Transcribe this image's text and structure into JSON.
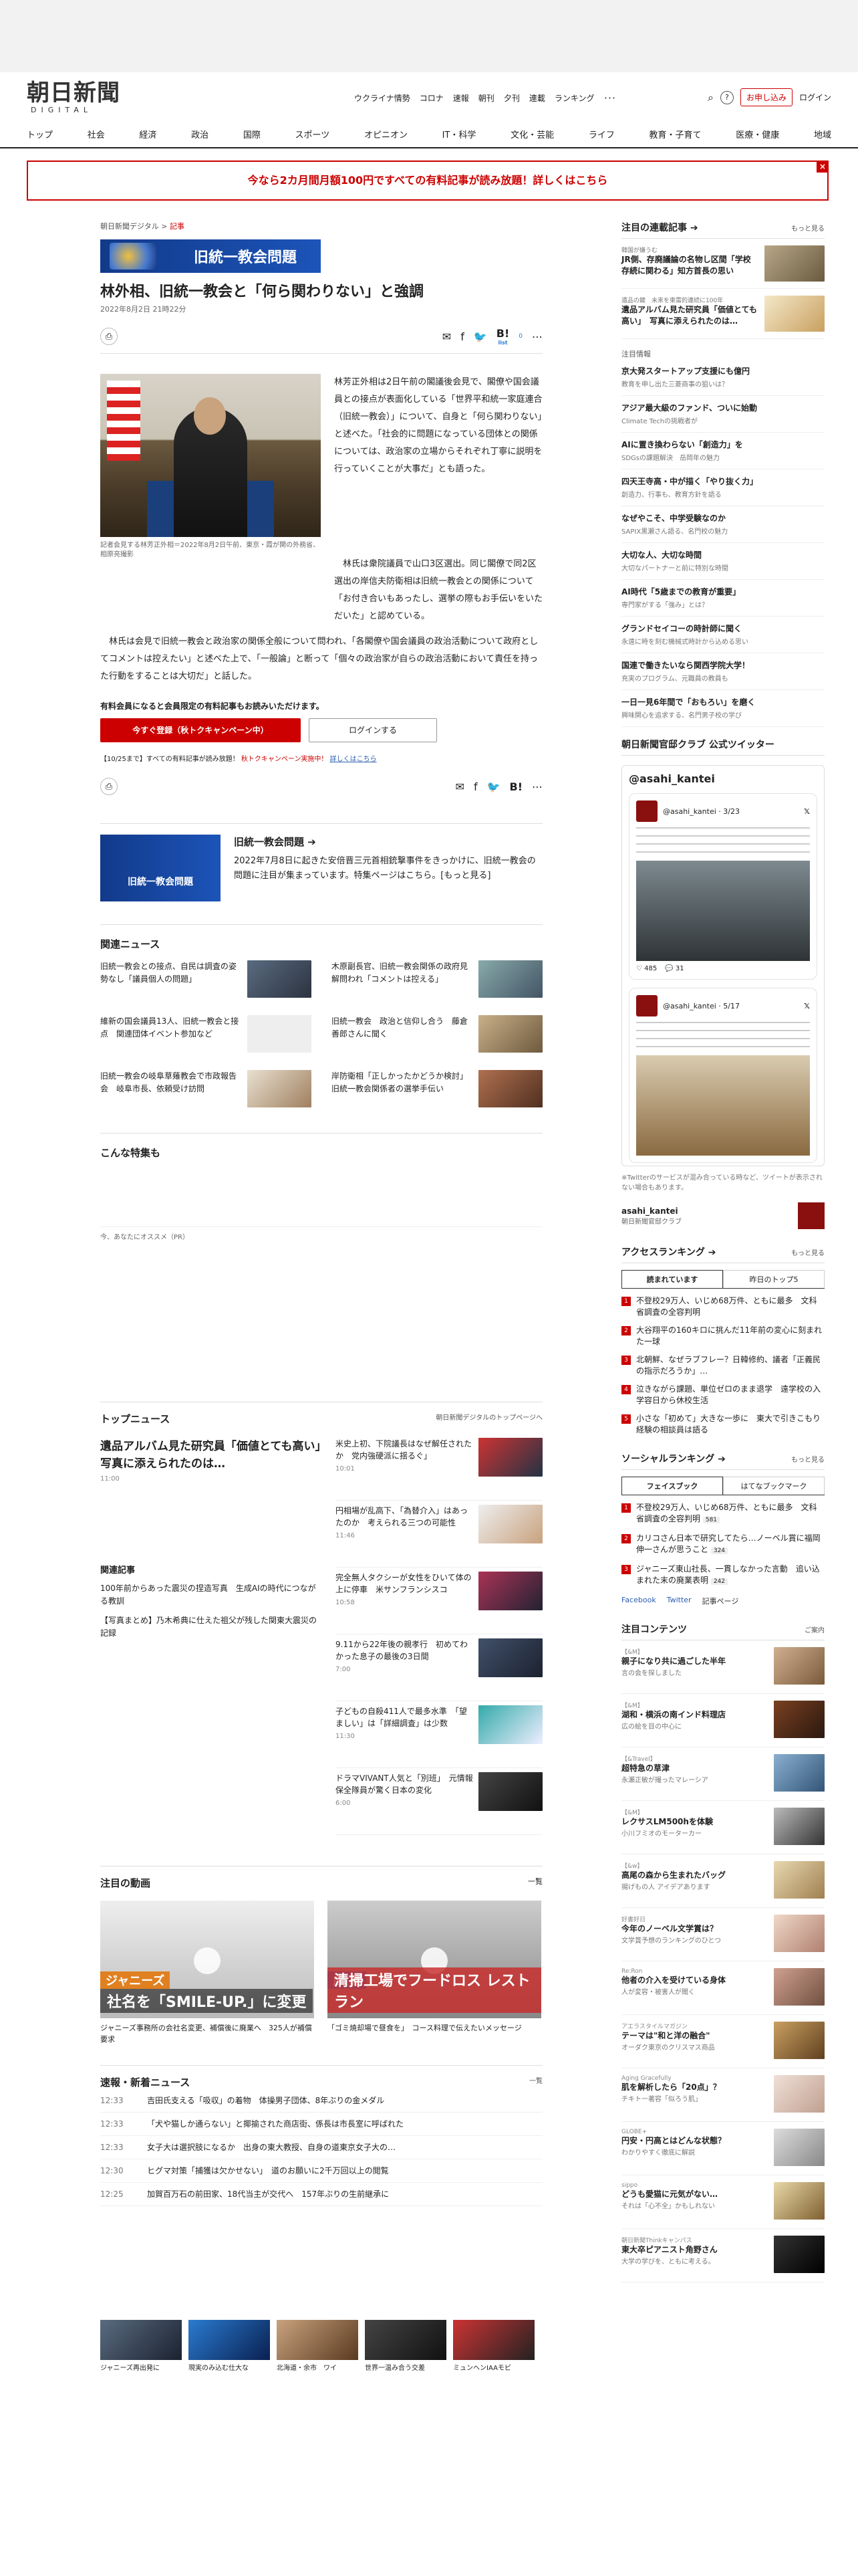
{
  "header": {
    "logo_main": "朝日新聞",
    "logo_sub": "DIGITAL",
    "links": [
      "ウクライナ情勢",
      "コロナ",
      "速報",
      "朝刊",
      "夕刊",
      "連載",
      "ランキング",
      "･･･"
    ],
    "help": "?",
    "subscribe": "お申し込み",
    "login": "ログイン"
  },
  "nav": [
    "トップ",
    "社会",
    "経済",
    "政治",
    "国際",
    "スポーツ",
    "オピニオン",
    "IT・科学",
    "文化・芸能",
    "ライフ",
    "教育・子育て",
    "医療・健康",
    "地域"
  ],
  "banner": {
    "text": "今なら2カ月間月額100円ですべての有料記事が読み放題！詳しくはこちら",
    "close": "×"
  },
  "article": {
    "breadcrumb": "朝日新聞デジタル",
    "breadcrumb_sep": ">",
    "breadcrumb_cur": "記事",
    "tag": "旧統一教会問題",
    "title": "林外相、旧統一教会と「何ら関わりない」と強調",
    "date": "2022年8月2日 21時22分",
    "print": "⎙",
    "share_list": "list",
    "share_count": "0",
    "caption": "記者会見する林芳正外相＝2022年8月2日午前、東京・霞が関の外務省、相原亮撮影",
    "p1": "林芳正外相は2日午前の閣議後会見で、閣僚や国会議員との接点が表面化している「世界平和統一家庭連合（旧統一教会）」について、自身と「何ら関わりない」と述べた。「社会的に問題になっている団体との関係については、政治家の立場からそれぞれ丁寧に説明を行っていくことが大事だ」とも語った。",
    "p2": "林氏は衆院議員で山口3区選出。同じ閣僚で同2区選出の岸信夫防衛相は旧統一教会との関係について「お付き合いもあったし、選挙の際もお手伝いをいただいた」と認めている。",
    "p3": "林氏は会見で旧統一教会と政治家の関係全般について問われ、「各閣僚や国会議員の政治活動について政府としてコメントは控えたい」と述べた上で、「一般論」と断って「個々の政治家が自らの政治活動において責任を持った行動をすることは大切だ」と話した。",
    "register_text": "有料会員になると会員限定の有料記事もお読みいただけます。",
    "register_btn": "今すぐ登録（秋トクキャンペーン中）",
    "login_btn": "ログインする",
    "campaign_pre": "【10/25まで】すべての有料記事が読み放題！",
    "campaign_red": "秋トクキャンペーン実施中！",
    "campaign_post": "詳しくはこちら"
  },
  "topic": {
    "image_label": "旧統一教会問題",
    "title": "旧統一教会問題 ➔",
    "desc": "2022年7月8日に起きた安倍晋三元首相銃撃事件をきっかけに、旧統一教会の問題に注目が集まっています。特集ページはこちら。[もっと見る]"
  },
  "related": {
    "title": "関連ニュース",
    "items": [
      "旧統一教会との接点、自民は調査の姿勢なし「議員個人の問題」",
      "木原副長官、旧統一教会関係の政府見解問われ「コメントは控える」",
      "維新の国会議員13人、旧統一教会と接点　関連団体イベント参加など",
      "旧統一教会　政治と信仰し合う　藤倉善郎さんに聞く",
      "旧統一教会の岐阜草薙教会で市政報告会　岐阜市長、依頼受け訪問",
      "岸防衛相「正しかったかどうか検討」　旧統一教会関係者の選挙手伝い"
    ],
    "more_title": "こんな特集も",
    "pr": "今、あなたにオススメ（PR）"
  },
  "topnews": {
    "title": "トップニュース",
    "more": "朝日新聞デジタルのトップページへ",
    "lead": "遺品アルバム見た研究員「価値とても高い」　写真に添えられたのは…",
    "lead_time": "11:00",
    "items": [
      {
        "t": "米史上初、下院議長はなぜ解任されたか　党内強硬派に揺るぐ」",
        "tm": "10:01"
      },
      {
        "t": "円相場が乱高下、「為替介入」はあったのか　考えられる三つの可能性",
        "tm": "11:46"
      },
      {
        "t": "完全無人タクシーが女性をひいて体の上に停車　米サンフランシスコ",
        "tm": "10:58"
      },
      {
        "t": "9.11から22年後の親孝行　初めてわかった息子の最後の3日間",
        "tm": "7:00"
      },
      {
        "t": "子どもの自殺411人で最多水準　「望ましい」は「詳細調査」は少数",
        "tm": "11:30"
      },
      {
        "t": "ドラマVIVANT人気と「別班」　元情報保全隊員が驚く日本の変化",
        "tm": "6:00"
      }
    ],
    "related_head": "関連記事",
    "related_items": [
      "100年前からあった震災の捏造写真　生成AIの時代につながる教訓",
      "【写真まとめ】乃木希典に仕えた祖父が残した関東大震災の記録"
    ]
  },
  "videos": {
    "title": "注目の動画",
    "more": "一覧",
    "items": [
      {
        "tag": "ジャニーズ",
        "cap": "社名を「SMILE-UP.」に変更",
        "title": "ジャニーズ事務所の会社名変更、補償後に廃業へ　325人が補償要求"
      },
      {
        "tag": "広 島",
        "cap": "清掃工場でフードロス レストラン",
        "title": "「ゴミ焼却場で昼食を」　コース料理で伝えたいメッセージ"
      }
    ]
  },
  "breaking": {
    "title": "速報・新着ニュース",
    "more": "一覧",
    "items": [
      {
        "tm": "12:33",
        "t": "吉田氏支える「吸収」の着物　体操男子団体、8年ぶりの金メダル"
      },
      {
        "tm": "12:33",
        "t": "「犬や猫しか通らない」と揶揄された商店街、係長は市長室に呼ばれた"
      },
      {
        "tm": "12:33",
        "t": "女子大は選択肢になるか　出身の東大教授、自身の道東京女子大の…"
      },
      {
        "tm": "12:30",
        "t": "ヒグマ対策「捕獲は欠かせない」　道のお願いに2千万回以上の閲覧"
      },
      {
        "tm": "12:25",
        "t": "加賀百万石の前田家、18代当主が交代へ　157年ぶりの生前継承に"
      }
    ]
  },
  "bottom_thumbs": [
    "ジャニーズ再出発に",
    "現実のみ込む仕大な",
    "北海道・余市　ワイ",
    "世界一温み合う交差",
    "ミュンヘンIAAモビ"
  ],
  "side": {
    "serial_title": "注目の連載記事 ➔",
    "serial_more": "もっと見る",
    "serial_items": [
      {
        "k": "韓国が嫌うむ",
        "t": "JR側、存廃議論の名物し区間「学校存続に関わる」知方首長の思い"
      },
      {
        "k": "遺品の鍵　未来を東需的連続に100年",
        "t": "遺品アルバム見た研究員「価値とても高い」　写真に添えられたのは…"
      }
    ],
    "chumoku": "注目情報",
    "ch_items": [
      {
        "t": "京大発スタートアップ支援にも億円",
        "s": "教育を申し出た三菱商事の狙いは？"
      },
      {
        "t": "アジア最大級のファンド、ついに始動",
        "s": "Climate Techの挑戦者が"
      },
      {
        "t": "AIに置き換わらない「創造力」を",
        "s": "SDGsの課題解決　岳岡年の魅力"
      },
      {
        "t": "四天王寺高・中が描く「やり抜く力」",
        "s": "創造力、行事も、教育方針を語る"
      },
      {
        "t": "なぜやこそ、中学受験なのか",
        "s": "SAPIX黒瀬さん語る、名門校の魅力"
      },
      {
        "t": "大切な人、大切な時間",
        "s": "大切なパートナーと前に特別な時間"
      },
      {
        "t": "AI時代「5歳までの教育が重要」",
        "s": "専門家がする「強み」とは？"
      },
      {
        "t": "グランドセイコーの時計師に聞く",
        "s": "永遠に時を刻む機械式時計から込める思い"
      },
      {
        "t": "国連で働きたいなら関西学院大学！",
        "s": "充実のプログラム、元職員の教員も"
      },
      {
        "t": "一日一見6年間で「おもろい」を磨く",
        "s": "興味関心を追求する、名門男子校の学び"
      }
    ],
    "twitter_title": "朝日新聞官邸クラブ 公式ツイッター",
    "twitter_handle": "@asahi_kantei",
    "tweet1_user": "@asahi_kantei · 3/23",
    "tweet1_stats": "485",
    "tweet1_reply": "31",
    "tweet2_user": "@asahi_kantei · 5/17",
    "tw_note": "※Twitterのサービスが混み合っている時など、ツイートが表示されない場合もあります。",
    "acc_name": "asahi_kantei",
    "acc_sub": "朝日新聞官邸クラブ",
    "access_title": "アクセスランキング ➔",
    "access_more": "もっと見る",
    "access_tabs": [
      "読まれています",
      "昨日のトップ5"
    ],
    "access_items": [
      "不登校29万人、いじめ68万件、ともに最多　文科省調査の全容判明",
      "大谷翔平の160キロに挑んだ11年前の変心に刻まれた一球",
      "北朝鮮、なぜラブフレー？日韓修約、議者「正義民の指示だろうか」…",
      "泣きながら課題、単位ゼロのまま退学　遠学校の入学容日から休校生活",
      "小さな「初めて」大きな一歩に　東大で引きこもり経験の相談員は語る"
    ],
    "social_title": "ソーシャルランキング ➔",
    "social_more": "もっと見る",
    "social_tabs": [
      "フェイスブック",
      "はてなブックマーク"
    ],
    "social_items": [
      {
        "t": "不登校29万人、いじめ68万件、ともに最多　文科省調査の全容判明",
        "c": "581"
      },
      {
        "t": "カリコさん日本で研究してたら…ノーベル賞に福岡伸一さんが思うこと",
        "c": "324"
      },
      {
        "t": "ジャニーズ東山社長、一貫しなかった言動　追い込まれた末の廃業表明",
        "c": "242"
      }
    ],
    "social_links": [
      "Facebook",
      "Twitter",
      "記事ページ"
    ],
    "contents_title": "注目コンテンツ",
    "contents_more": "ご案内",
    "contents": [
      {
        "k": "【&M】",
        "t": "親子になり共に過ごした半年",
        "s": "言の会を探しました"
      },
      {
        "k": "【&M】",
        "t": "湖和・横浜の南インド料理店",
        "s": "広の絵を目の中心に"
      },
      {
        "k": "【&Travel】",
        "t": "超特急の草津",
        "s": "永瀬正敏が撮ったマレーシア"
      },
      {
        "k": "【&M】",
        "t": "レクサスLM500hを体験",
        "s": "小川フミオのモーターカー"
      },
      {
        "k": "【&w】",
        "t": "高尾の森から生まれたバッグ",
        "s": "揚げもの人 アイデアあります"
      },
      {
        "k": "好書好日",
        "t": "今年のノーベル文学賞は？",
        "s": "文学賞予想のランキングのひとつ"
      },
      {
        "k": "Re:Ron",
        "t": "他者の介入を受けている身体",
        "s": "人が変容・被害人が聞く"
      },
      {
        "k": "アエラスタイルマガジン",
        "t": "テーマは\"和と洋の融合\"",
        "s": "オーダク東京のクリスマス商品"
      },
      {
        "k": "Aging Gracefully",
        "t": "肌を解析したら「20点」？",
        "s": "チキト一著容「似ろう肌」"
      },
      {
        "k": "GLOBE+",
        "t": "円安・円高とはどんな状態？",
        "s": "わかりやすく徹底に解説"
      },
      {
        "k": "sippo",
        "t": "どうも愛猫に元気がない…",
        "s": "それは「心不全」かもしれない"
      },
      {
        "k": "朝日新聞Thinkキャンパス",
        "t": "東大卒ピアニスト角野さん",
        "s": "大学の学びを、ともに考える。"
      }
    ]
  }
}
